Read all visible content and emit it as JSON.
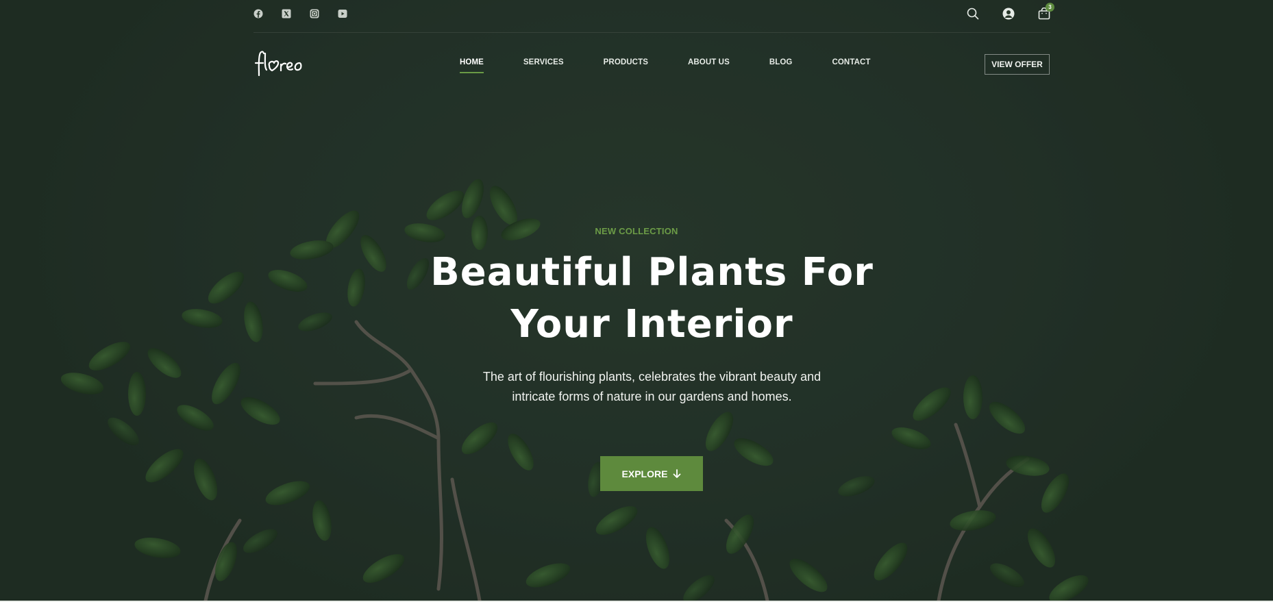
{
  "social": [
    {
      "icon": "facebook-icon"
    },
    {
      "icon": "x-twitter-icon"
    },
    {
      "icon": "instagram-icon"
    },
    {
      "icon": "youtube-icon"
    }
  ],
  "actions": {
    "search_icon": "search-icon",
    "account_icon": "user-icon",
    "cart_icon": "shopping-bag-icon",
    "cart_count": "3"
  },
  "brand": {
    "logo_text": "floreo"
  },
  "nav": {
    "items": [
      {
        "label": "HOME",
        "active": true
      },
      {
        "label": "SERVICES",
        "active": false
      },
      {
        "label": "PRODUCTS",
        "active": false
      },
      {
        "label": "ABOUT US",
        "active": false
      },
      {
        "label": "BLOG",
        "active": false
      },
      {
        "label": "CONTACT",
        "active": false
      }
    ],
    "cta_label": "VIEW OFFER"
  },
  "hero": {
    "eyebrow": "NEW COLLECTION",
    "headline_line1": "Beautiful Plants For",
    "headline_line2": "Your Interior",
    "sub_line1": "The art of flourishing plants, celebrates the vibrant beauty and",
    "sub_line2": "intricate forms of nature in our gardens and homes.",
    "button_label": "EXPLORE"
  },
  "colors": {
    "accent": "#5e8a3d",
    "background": "#273629",
    "eyebrow": "#6c9c47"
  }
}
